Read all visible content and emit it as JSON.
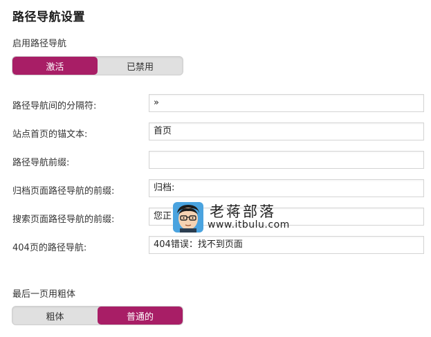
{
  "page": {
    "title": "路径导航设置"
  },
  "enable_section": {
    "label": "启用路径导航",
    "options": [
      {
        "label": "激活",
        "active": true
      },
      {
        "label": "已禁用",
        "active": false
      }
    ]
  },
  "fields": [
    {
      "label": "路径导航间的分隔符:",
      "value": "»"
    },
    {
      "label": "站点首页的锚文本:",
      "value": "首页"
    },
    {
      "label": "路径导航前缀:",
      "value": ""
    },
    {
      "label": "归档页面路径导航的前缀:",
      "value": "归档:"
    },
    {
      "label": "搜索页面路径导航的前缀:",
      "value": "您正"
    },
    {
      "label": "404页的路径导航:",
      "value": "404错误：找不到页面"
    }
  ],
  "bold_section": {
    "label": "最后一页用粗体",
    "options": [
      {
        "label": "粗体",
        "active": false
      },
      {
        "label": "普通的",
        "active": true
      }
    ]
  },
  "watermark": {
    "brand": "老蒋部落",
    "domain": "www.itbulu.com"
  },
  "colors": {
    "accent": "#a81e66",
    "toggle_bg": "#e0e0e0",
    "input_border": "#d4d4d4"
  }
}
